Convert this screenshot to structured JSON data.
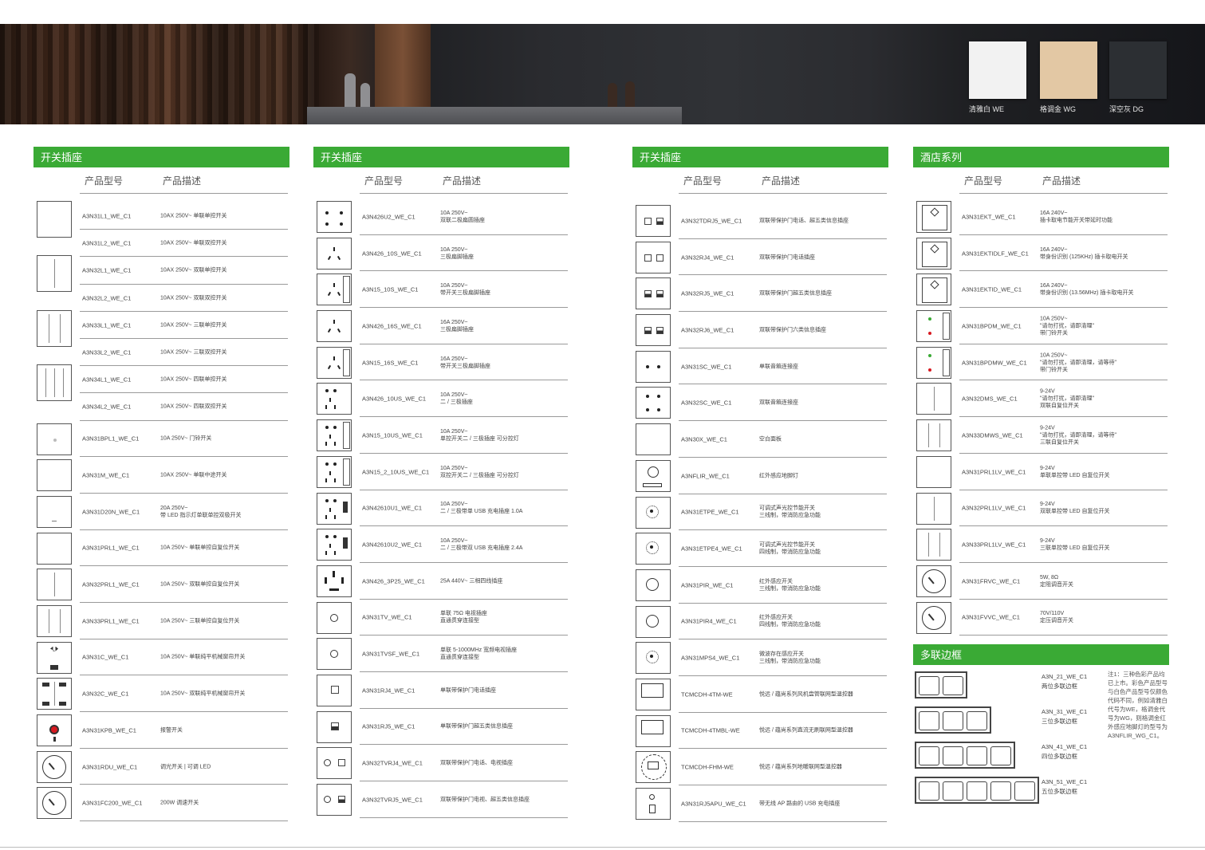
{
  "hero": {
    "finishes": [
      {
        "label": "清雅白 WE",
        "color": "#f2f2f2"
      },
      {
        "label": "格调金 WG",
        "color": "#e3c8a4"
      },
      {
        "label": "深空灰 DG",
        "color": "#2c2f33"
      }
    ]
  },
  "headers": {
    "code": "产品型号",
    "desc": "产品描述"
  },
  "columns": [
    {
      "title": "开关插座",
      "rows": [
        {
          "icon": "g1",
          "code": "A3N31L1_WE_C1",
          "desc": "10AX 250V~ 单联单控开关"
        },
        {
          "icon": "none",
          "code": "A3N31L2_WE_C1",
          "desc": "10AX 250V~ 单联双控开关"
        },
        {
          "icon": "g2",
          "code": "A3N32L1_WE_C1",
          "desc": "10AX 250V~ 双联单控开关"
        },
        {
          "icon": "none",
          "code": "A3N32L2_WE_C1",
          "desc": "10AX 250V~ 双联双控开关"
        },
        {
          "icon": "g3",
          "code": "A3N33L1_WE_C1",
          "desc": "10AX 250V~ 三联单控开关"
        },
        {
          "icon": "none",
          "code": "A3N33L2_WE_C1",
          "desc": "10AX 250V~ 三联双控开关"
        },
        {
          "icon": "g4",
          "code": "A3N34L1_WE_C1",
          "desc": "10AX 250V~ 四联单控开关"
        },
        {
          "icon": "none",
          "code": "A3N34L2_WE_C1",
          "desc": "10AX 250V~ 四联双控开关"
        },
        {
          "icon": "bell",
          "code": "A3N31BPL1_WE_C1",
          "desc": "10A 250V~ 门铃开关"
        },
        {
          "icon": "g1",
          "code": "A3N31M_WE_C1",
          "desc": "10AX 250V~ 单联中途开关"
        },
        {
          "icon": "led",
          "code": "A3N31D20N_WE_C1",
          "desc": "20A 250V~\n带 LED 指示灯单联单控双极开关"
        },
        {
          "icon": "g1",
          "code": "A3N31PRL1_WE_C1",
          "desc": "10A 250V~ 单联单控自复位开关"
        },
        {
          "icon": "g2",
          "code": "A3N32PRL1_WE_C1",
          "desc": "10A 250V~ 双联单控自复位开关"
        },
        {
          "icon": "g3",
          "code": "A3N33PRL1_WE_C1",
          "desc": "10A 250V~ 三联单控自复位开关"
        },
        {
          "icon": "curtain",
          "code": "A3N31C_WE_C1",
          "desc": "10A 250V~ 单联纯平机械窗帘开关"
        },
        {
          "icon": "curtain2",
          "code": "A3N32C_WE_C1",
          "desc": "10A 250V~ 双联纯平机械窗帘开关"
        },
        {
          "icon": "alarm",
          "code": "A3N31KPB_WE_C1",
          "desc": "报警开关"
        },
        {
          "icon": "knob",
          "code": "A3N31RDU_WE_C1",
          "desc": "调光开关 | 可调 LED"
        },
        {
          "icon": "knob",
          "code": "A3N31FC200_WE_C1",
          "desc": "200W 调速开关"
        }
      ]
    },
    {
      "title": "开关插座",
      "rows": [
        {
          "icon": "s2",
          "code": "A3N426U2_WE_C1",
          "desc": "10A 250V~\n双联二极扁圆插座"
        },
        {
          "icon": "s3",
          "code": "A3N426_10S_WE_C1",
          "desc": "10A 250V~\n三极扁脚插座"
        },
        {
          "icon": "s3sw",
          "code": "A3N15_10S_WE_C1",
          "desc": "10A 250V~\n带开关三极扁脚插座"
        },
        {
          "icon": "s3",
          "code": "A3N426_16S_WE_C1",
          "desc": "16A 250V~\n三极扁脚插座"
        },
        {
          "icon": "s3sw",
          "code": "A3N15_16S_WE_C1",
          "desc": "16A 250V~\n带开关三极扁脚插座"
        },
        {
          "icon": "s5",
          "code": "A3N426_10US_WE_C1",
          "desc": "10A 250V~\n二 / 三极插座"
        },
        {
          "icon": "s5sw",
          "code": "A3N15_10US_WE_C1",
          "desc": "10A 250V~\n单控开关二 / 三极插座 可分控灯"
        },
        {
          "icon": "s5sw",
          "code": "A3N15_2_10US_WE_C1",
          "desc": "10A 250V~\n双控开关二 / 三极插座 可分控灯"
        },
        {
          "icon": "s5usb",
          "code": "A3N42610U1_WE_C1",
          "desc": "10A 250V~\n二 / 三极带单 USB 充电插座 1.0A"
        },
        {
          "icon": "s5usb",
          "code": "A3N42610U2_WE_C1",
          "desc": "10A 250V~\n二 / 三极带双 USB 充电插座 2.4A"
        },
        {
          "icon": "s4",
          "code": "A3N426_3P25_WE_C1",
          "desc": "25A 440V~ 三相四线插座"
        },
        {
          "icon": "tv",
          "code": "A3N31TV_WE_C1",
          "desc": "单联 75Ω 电视插座\n直通贯穿连接型"
        },
        {
          "icon": "tv",
          "code": "A3N31TVSF_WE_C1",
          "desc": "单联 5-1000MHz 宽频电视插座\n直通贯穿连接型"
        },
        {
          "icon": "rj",
          "code": "A3N31RJ4_WE_C1",
          "desc": "单联带保护门电话插座"
        },
        {
          "icon": "rj5",
          "code": "A3N31RJ5_WE_C1",
          "desc": "单联带保护门超五类信息插座"
        },
        {
          "icon": "tvrj",
          "code": "A3N32TVRJ4_WE_C1",
          "desc": "双联带保护门电话、电视插座"
        },
        {
          "icon": "tvrj5",
          "code": "A3N32TVRJ5_WE_C1",
          "desc": "双联带保护门电视、超五类信息插座"
        }
      ]
    },
    {
      "title": "开关插座",
      "rows": [
        {
          "icon": "rjrj5",
          "code": "A3N32TDRJ5_WE_C1",
          "desc": "双联带保护门电话、超五类信息插座"
        },
        {
          "icon": "rjrj",
          "code": "A3N32RJ4_WE_C1",
          "desc": "双联带保护门电话插座"
        },
        {
          "icon": "rj5rj5",
          "code": "A3N32RJ5_WE_C1",
          "desc": "双联带保护门超五类信息插座"
        },
        {
          "icon": "rj5rj5",
          "code": "A3N32RJ6_WE_C1",
          "desc": "双联带保护门六类信息插座"
        },
        {
          "icon": "spk1",
          "code": "A3N31SC_WE_C1",
          "desc": "单联音箱连接座"
        },
        {
          "icon": "spk2",
          "code": "A3N32SC_WE_C1",
          "desc": "双联音箱连接座"
        },
        {
          "icon": "blank",
          "code": "A3N30X_WE_C1",
          "desc": "空白面板"
        },
        {
          "icon": "flir",
          "code": "A3NFLIR_WE_C1",
          "desc": "红外感应地脚灯"
        },
        {
          "icon": "sound",
          "code": "A3N31ETPE_WE_C1",
          "desc": "可调式声光控节能开关\n三线制，带消防应急功能"
        },
        {
          "icon": "sound",
          "code": "A3N31ETPE4_WE_C1",
          "desc": "可调式声光控节能开关\n四线制，带消防应急功能"
        },
        {
          "icon": "pir",
          "code": "A3N31PIR_WE_C1",
          "desc": "红外感应开关\n三线制，带消防应急功能"
        },
        {
          "icon": "pir",
          "code": "A3N31PIR4_WE_C1",
          "desc": "红外感应开关\n四线制，带消防应急功能"
        },
        {
          "icon": "sound",
          "code": "A3N31MPS4_WE_C1",
          "desc": "微波存在感应开关\n三线制，带消防应急功能"
        },
        {
          "icon": "thermo",
          "code": "TCMCDH-4TM-WE",
          "desc": "悦远 / 蕴尚系列风机盘管联网型温控器"
        },
        {
          "icon": "thermo",
          "code": "TCMCDH-4TMBL-WE",
          "desc": "悦远 / 蕴尚系列直流无刷联网型温控器"
        },
        {
          "icon": "thermo2",
          "code": "TCMCDH-FHM-WE",
          "desc": "悦远 / 蕴尚系列地暖联网型温控器"
        },
        {
          "icon": "usbap",
          "code": "A3N31RJ5APU_WE_C1",
          "desc": "带无线 AP 路由的 USB 充电插座"
        }
      ]
    },
    {
      "title": "酒店系列",
      "rows": [
        {
          "icon": "card",
          "code": "A3N31EKT_WE_C1",
          "desc": "16A 240V~\n插卡取电节能开关带延时功能"
        },
        {
          "icon": "card",
          "code": "A3N31EKTIDLF_WE_C1",
          "desc": "16A 240V~\n带身份识别 (125KHz) 插卡取电开关"
        },
        {
          "icon": "card",
          "code": "A3N31EKTID_WE_C1",
          "desc": "16A 240V~\n带身份识别 (13.56MHz) 插卡取电开关"
        },
        {
          "icon": "dnd",
          "code": "A3N31BPDM_WE_C1",
          "desc": "10A 250V~\n\"请勿打扰，请即清理\"\n带门铃开关"
        },
        {
          "icon": "dnd",
          "code": "A3N31BPDMW_WE_C1",
          "desc": "10A 250V~\n\"请勿打扰，请即清理，请等待\"\n带门铃开关"
        },
        {
          "icon": "g2",
          "code": "A3N32DMS_WE_C1",
          "desc": "9-24V\n\"请勿打扰，请即清理\"\n双联自复位开关"
        },
        {
          "icon": "g3",
          "code": "A3N33DMWS_WE_C1",
          "desc": "9-24V\n\"请勿打扰，请即清理，请等待\"\n三联自复位开关"
        },
        {
          "icon": "g1",
          "code": "A3N31PRL1LV_WE_C1",
          "desc": "9-24V\n单联单控带 LED 自复位开关"
        },
        {
          "icon": "g2",
          "code": "A3N32PRL1LV_WE_C1",
          "desc": "9-24V\n双联单控带 LED 自复位开关"
        },
        {
          "icon": "g3",
          "code": "A3N33PRL1LV_WE_C1",
          "desc": "9-24V\n三联单控带 LED 自复位开关"
        },
        {
          "icon": "knob",
          "code": "A3N31FRVC_WE_C1",
          "desc": "5W, 8Ω\n定阻调音开关"
        },
        {
          "icon": "knob",
          "code": "A3N31FVVC_WE_C1",
          "desc": "70V/110V\n定压调音开关"
        }
      ],
      "frames_title": "多联边框",
      "frames": [
        {
          "cells": 2,
          "code": "A3N_21_WE_C1",
          "desc": "两位多联边框"
        },
        {
          "cells": 3,
          "code": "A3N_31_WE_C1",
          "desc": "三位多联边框"
        },
        {
          "cells": 4,
          "code": "A3N_41_WE_C1",
          "desc": "四位多联边框"
        },
        {
          "cells": 5,
          "code": "A3N_51_WE_C1",
          "desc": "五位多联边框"
        }
      ],
      "note": "注1：三种色彩产品均\n已上市。彩色产品型号\n与白色产品型号仅颜色\n代码不同，例如清雅白\n代号为WE，格调金代\n号为WG，则格调金红\n外感应地脚灯的型号为\nA3NFLIR_WG_C1。"
    }
  ]
}
